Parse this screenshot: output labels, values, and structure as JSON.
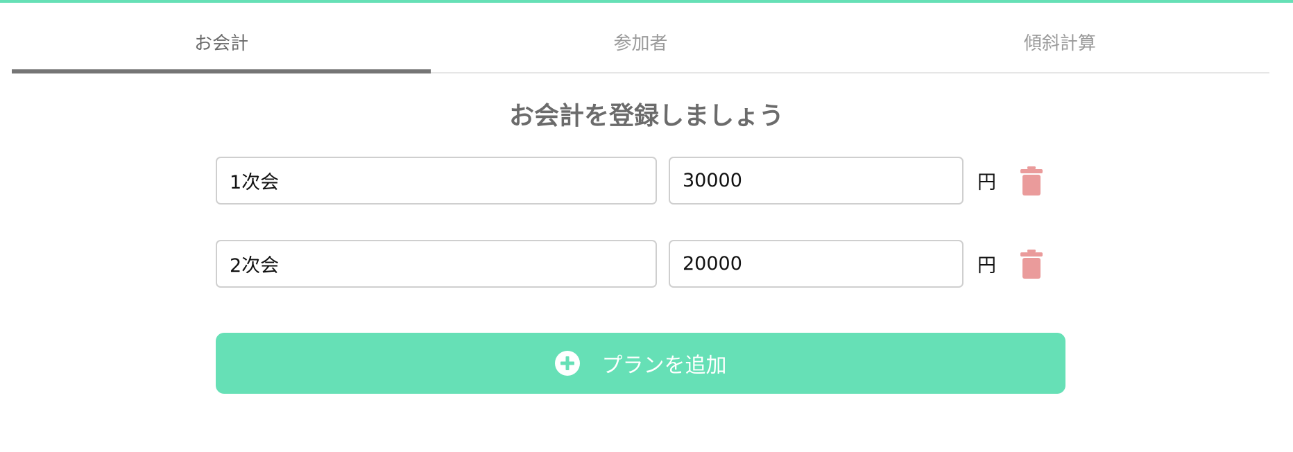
{
  "colors": {
    "accent": "#66e0b6",
    "delete": "#ea9b9b",
    "tab_underline": "#757575"
  },
  "tabs": [
    {
      "label": "お会計",
      "active": true
    },
    {
      "label": "参加者",
      "active": false
    },
    {
      "label": "傾斜計算",
      "active": false
    }
  ],
  "heading": "お会計を登録しましょう",
  "plans": [
    {
      "name": "1次会",
      "amount": "30000",
      "unit": "円",
      "delete_icon": "trash-icon"
    },
    {
      "name": "2次会",
      "amount": "20000",
      "unit": "円",
      "delete_icon": "trash-icon"
    }
  ],
  "add_button": {
    "icon": "plus-circle-icon",
    "label": "プランを追加"
  }
}
